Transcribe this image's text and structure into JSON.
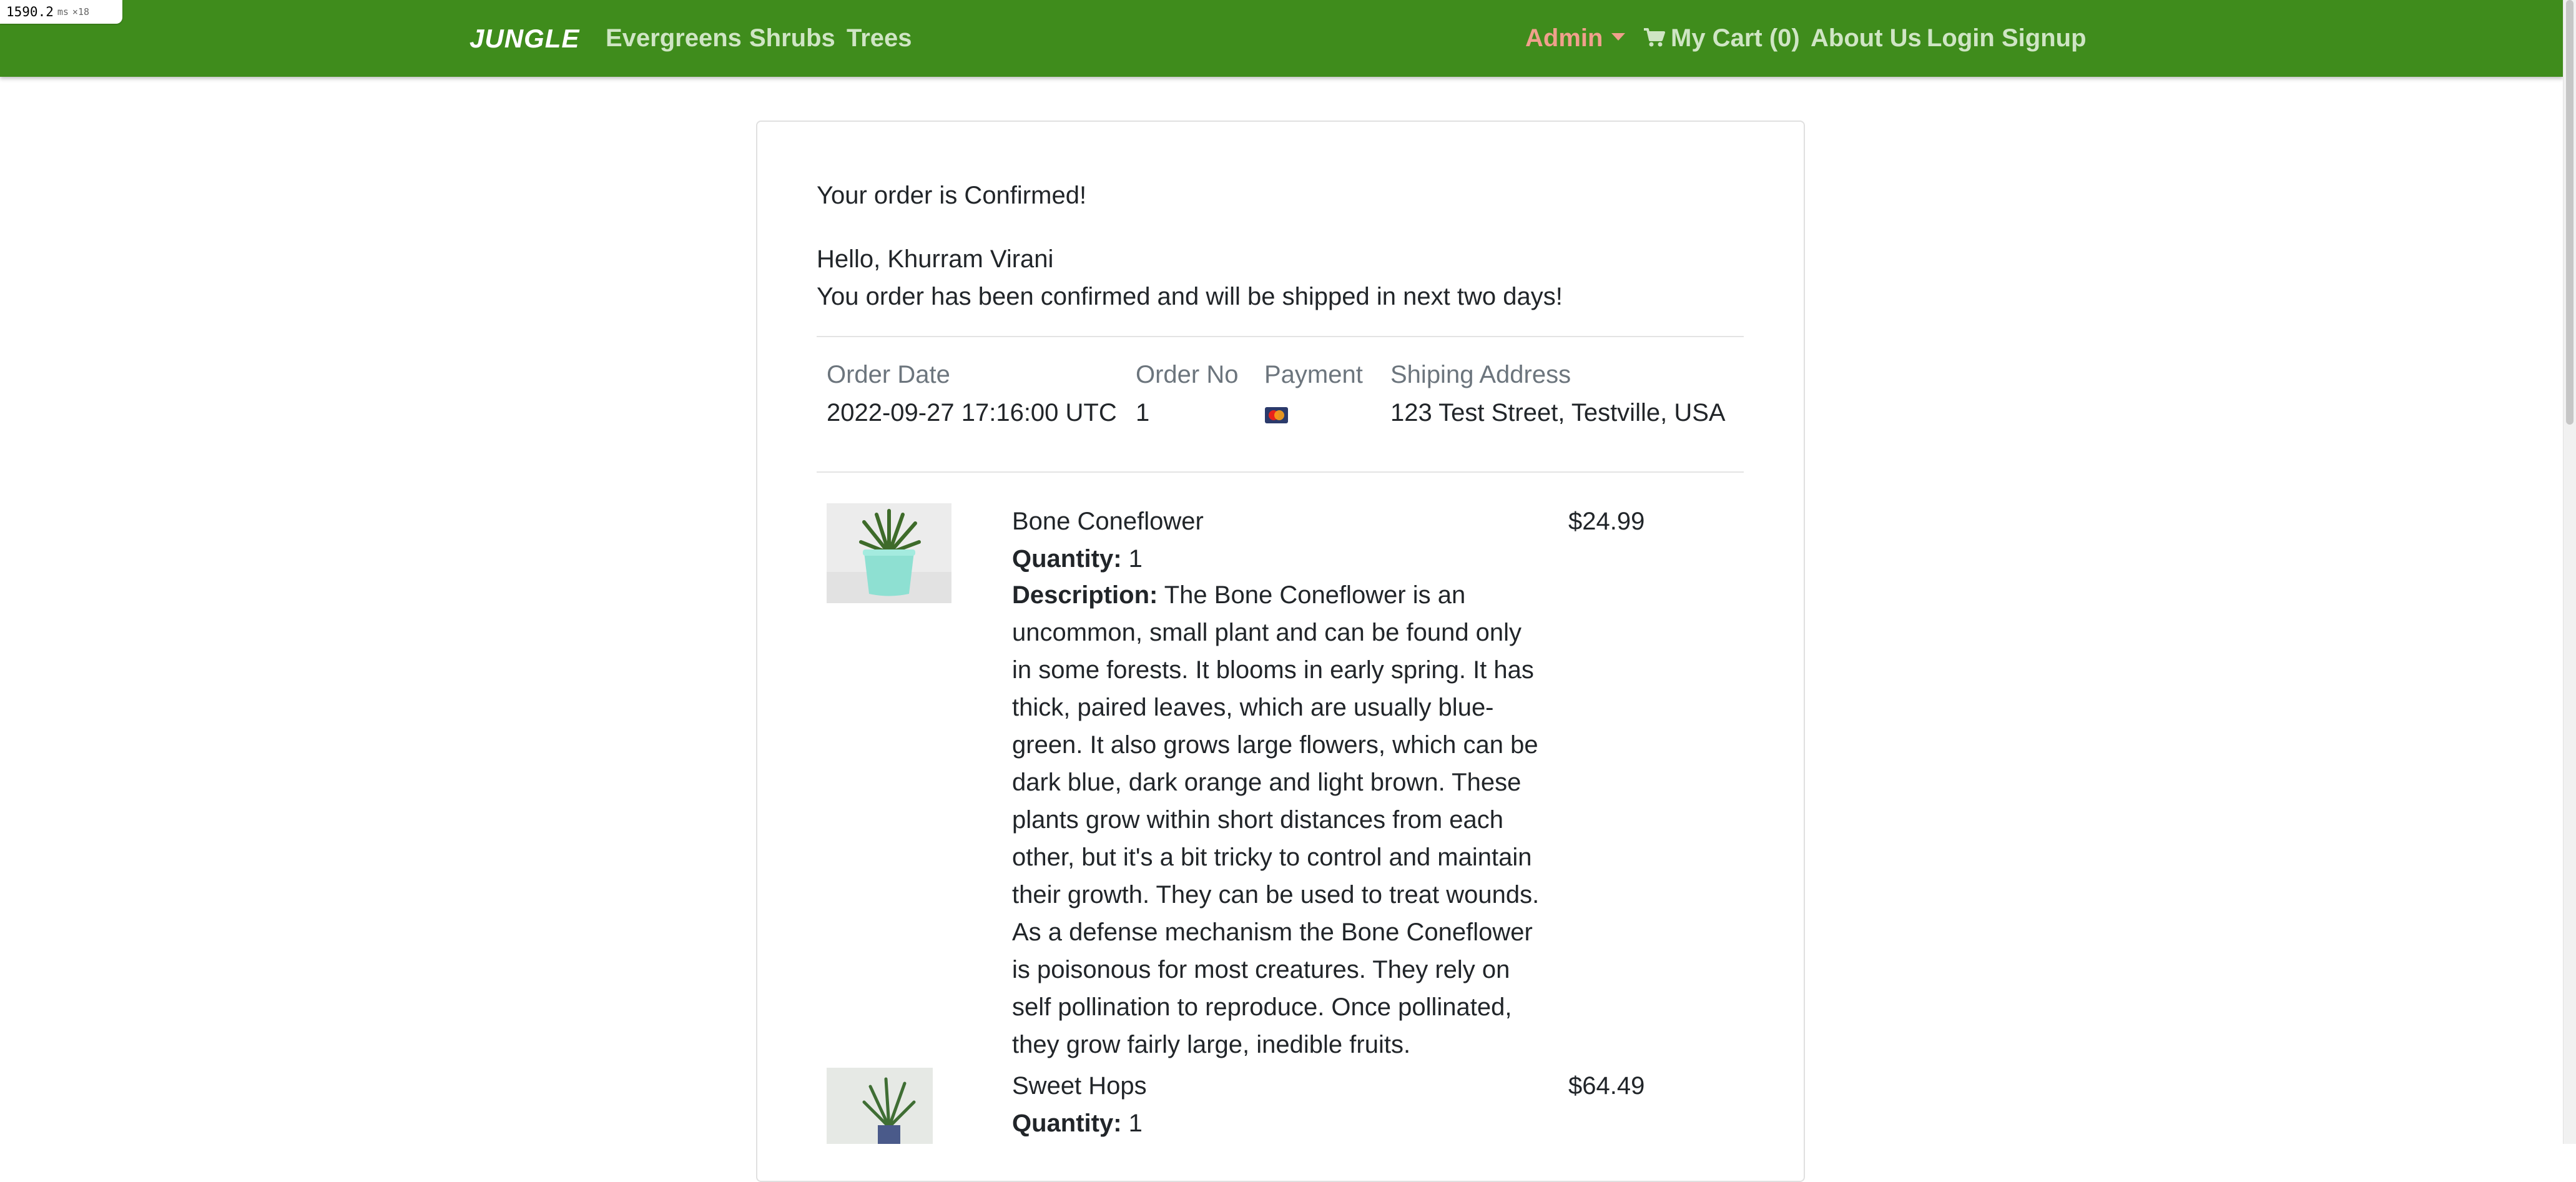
{
  "perf": {
    "value": "1590.2",
    "unit": "ms",
    "mult": "×18"
  },
  "nav": {
    "brand": "JUNGLE",
    "links": [
      "Evergreens",
      "Shrubs",
      "Trees"
    ],
    "admin": "Admin",
    "cart": "My Cart (0)",
    "about": "About Us",
    "login": "Login",
    "signup": "Signup"
  },
  "order": {
    "heading": "Your order is Confirmed!",
    "greeting": "Hello, Khurram Virani",
    "message": "You order has been confirmed and will be shipped in next two days!",
    "labels": {
      "date": "Order Date",
      "no": "Order No",
      "payment": "Payment",
      "address": "Shiping Address"
    },
    "date": "2022-09-27 17:16:00 UTC",
    "number": "1",
    "payment_icon": "mastercard-icon",
    "address": "123 Test Street, Testville, USA"
  },
  "items": [
    {
      "name": "Bone Coneflower",
      "price": "$24.99",
      "quantity_label": "Quantity:",
      "quantity": "1",
      "description_label": "Description:",
      "description": "The Bone Coneflower is an uncommon, small plant and can be found only in some forests. It blooms in early spring. It has thick, paired leaves, which are usually blue-green. It also grows large flowers, which can be dark blue, dark orange and light brown. These plants grow within short distances from each other, but it's a bit tricky to control and maintain their growth. They can be used to treat wounds. As a defense mechanism the Bone Coneflower is poisonous for most creatures. They rely on self pollination to reproduce. Once pollinated, they grow fairly large, inedible fruits."
    },
    {
      "name": "Sweet Hops",
      "price": "$64.49",
      "quantity_label": "Quantity:",
      "quantity": "1"
    }
  ],
  "colors": {
    "navbar": "#3f8c1c",
    "admin": "#f0a08c",
    "nav_link": "#cfe5c4"
  }
}
